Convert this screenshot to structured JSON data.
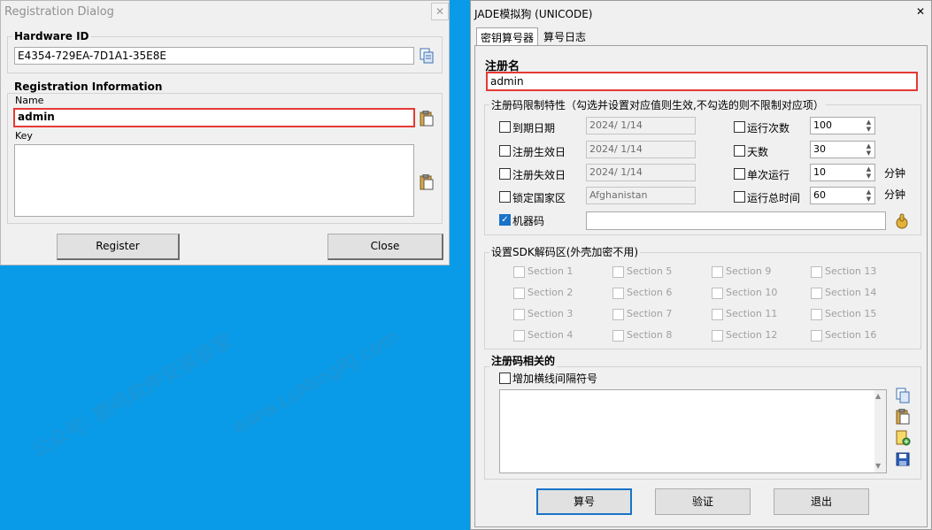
{
  "reg_dialog": {
    "title": "Registration Dialog",
    "close_glyph": "✕",
    "hardware_id_label": "Hardware ID",
    "hardware_id_value": "E4354-729EA-7D1A1-35E8E",
    "reg_info_label": "Registration Information",
    "name_label": "Name",
    "name_value": "admin",
    "key_label": "Key",
    "key_value": "",
    "register_button": "Register",
    "close_button": "Close"
  },
  "jade": {
    "title": "JADE模拟狗 (UNICODE)",
    "close_glyph": "✕",
    "tabs": [
      "密钥算号器",
      "算号日志"
    ],
    "reg_name_label": "注册名",
    "reg_name_value": "admin",
    "limits_label": "注册码限制特性（勾选并设置对应值则生效,不勾选的则不限制对应项）",
    "left_opts": [
      {
        "label": "到期日期",
        "date": "2024/ 1/14",
        "checked": false
      },
      {
        "label": "注册生效日",
        "date": "2024/ 1/14",
        "checked": false
      },
      {
        "label": "注册失效日",
        "date": "2024/ 1/14",
        "checked": false
      },
      {
        "label": "锁定国家区",
        "date": "Afghanistan",
        "checked": false
      }
    ],
    "right_opts": [
      {
        "label": "运行次数",
        "value": "100",
        "unit": ""
      },
      {
        "label": "天数",
        "value": "30",
        "unit": ""
      },
      {
        "label": "单次运行",
        "value": "10",
        "unit": "分钟"
      },
      {
        "label": "运行总时间",
        "value": "60",
        "unit": "分钟"
      }
    ],
    "machine_code_label": "机器码",
    "machine_code_checked": true,
    "machine_code_value": "",
    "sdk_label": "设置SDK解码区(外壳加密不用)",
    "sections": [
      "Section 1",
      "Section 5",
      "Section 9",
      "Section 13",
      "Section 2",
      "Section 6",
      "Section 10",
      "Section 14",
      "Section 3",
      "Section 7",
      "Section 11",
      "Section 15",
      "Section 4",
      "Section 8",
      "Section 12",
      "Section 16"
    ],
    "regcode_label": "注册码相关的",
    "add_dash_label": "增加横线间隔符号",
    "regcode_value": "",
    "buttons": {
      "calc": "算号",
      "verify": "验证",
      "exit": "退出"
    }
  },
  "colors": {
    "desktop": "#0a9be8",
    "highlight": "#e53935",
    "check": "#1a73c9"
  }
}
